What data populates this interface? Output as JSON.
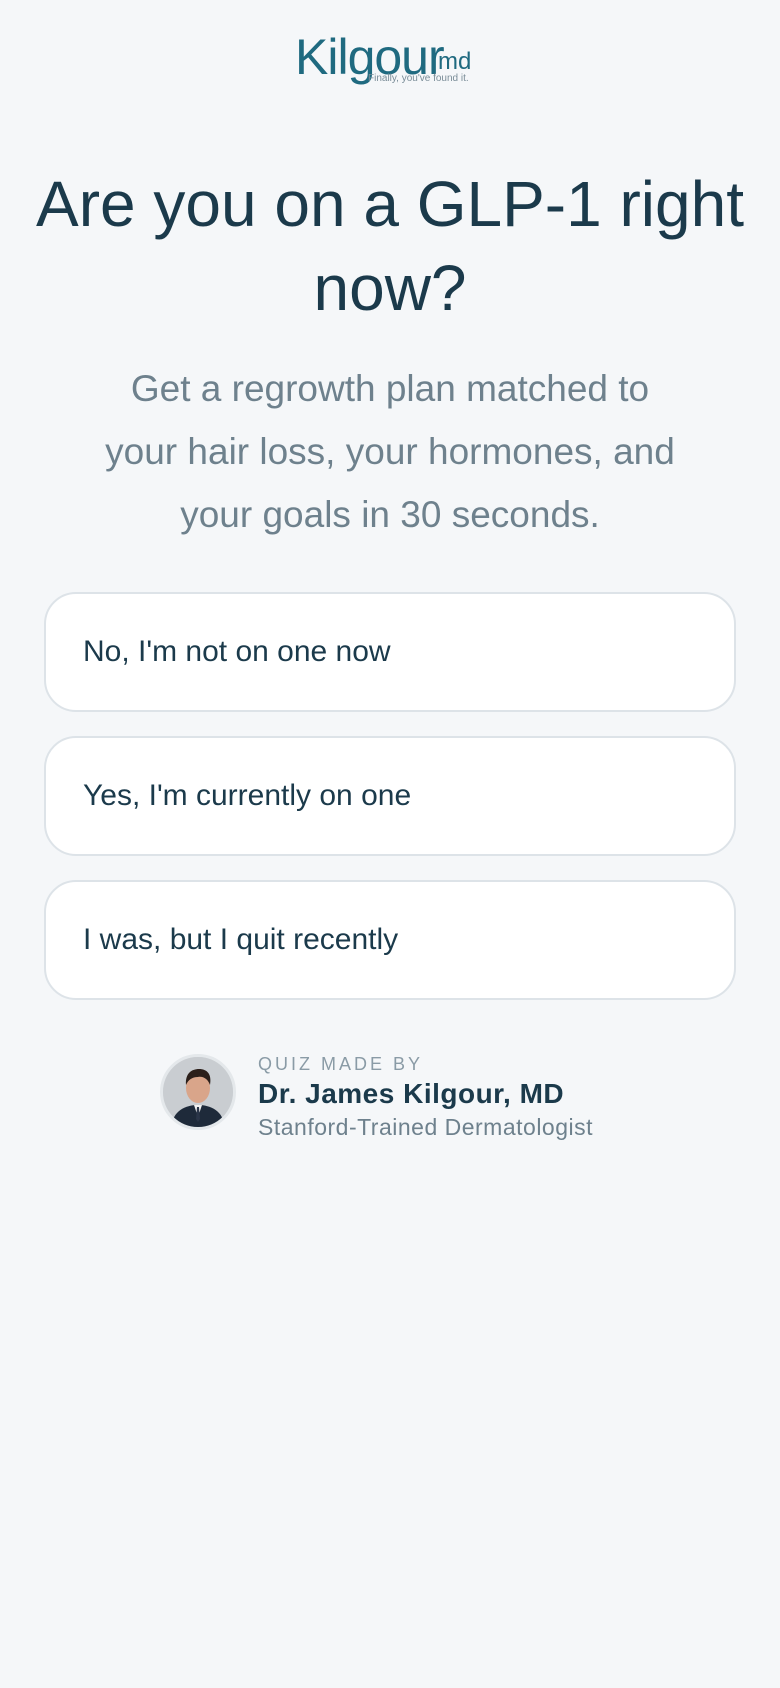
{
  "brand": {
    "logo_word": "Kilgour",
    "logo_suffix": "md",
    "tagline": "Finally, you've found it."
  },
  "question": {
    "headline": "Are you on a GLP-1 right now?",
    "subhead": "Get a regrowth plan matched to your hair loss, your hormones, and your goals in 30 seconds."
  },
  "options": [
    {
      "label": "No, I'm not on one now"
    },
    {
      "label": "Yes, I'm currently on one"
    },
    {
      "label": "I was, but I quit recently"
    }
  ],
  "author": {
    "eyebrow": "QUIZ MADE BY",
    "name": "Dr. James Kilgour, MD",
    "title": "Stanford-Trained Dermatologist"
  },
  "colors": {
    "background": "#f5f7f9",
    "text_primary": "#1b3a4b",
    "text_secondary": "#6e818d",
    "brand_teal": "#1f6a80",
    "card_border": "#dde3e8"
  }
}
